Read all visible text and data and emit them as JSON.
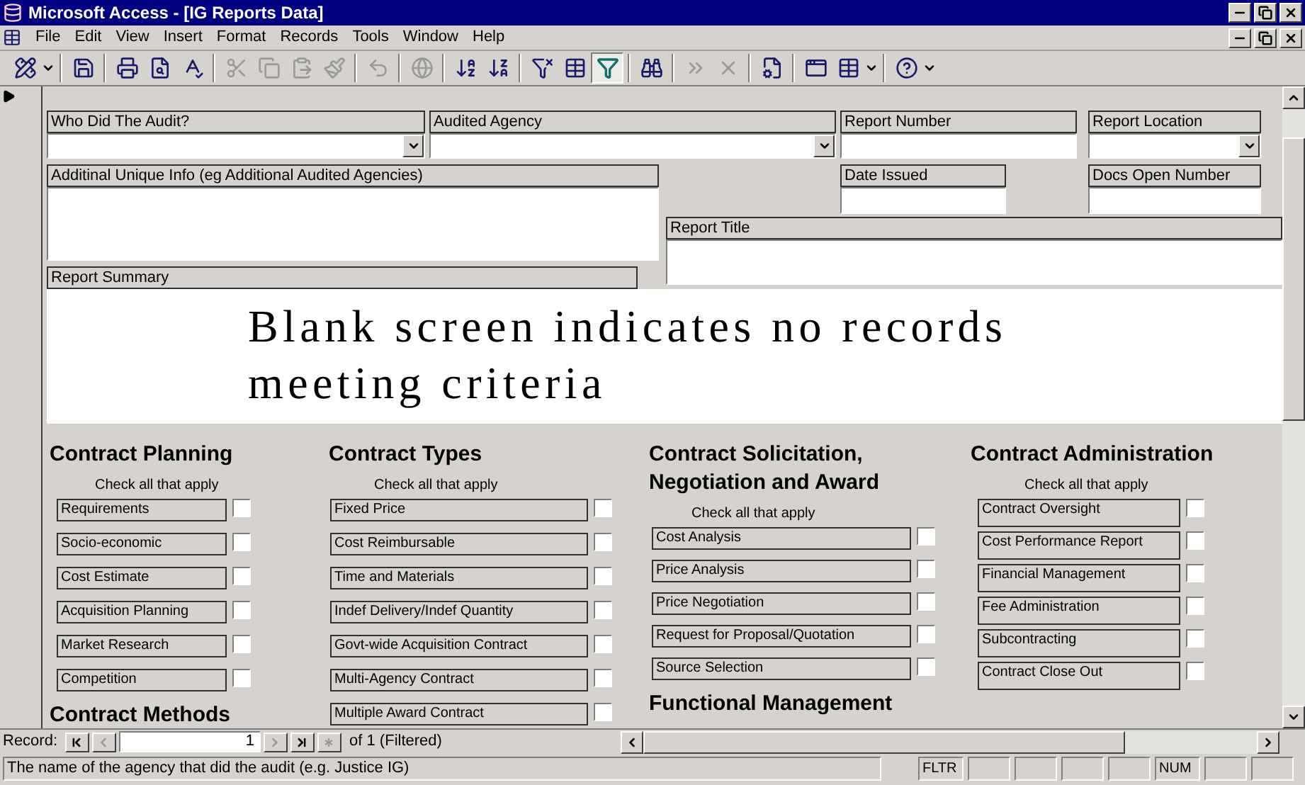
{
  "window": {
    "title": "Microsoft Access - [IG Reports Data]"
  },
  "menu": [
    "File",
    "Edit",
    "View",
    "Insert",
    "Format",
    "Records",
    "Tools",
    "Window",
    "Help"
  ],
  "toolbar": {
    "filter_on": true
  },
  "fields": [
    {
      "label": "Who Did The Audit?",
      "kind": "combo"
    },
    {
      "label": "Audited Agency",
      "kind": "combo"
    },
    {
      "label": "Report Number",
      "kind": "text"
    },
    {
      "label": "Report Location",
      "kind": "combo"
    },
    {
      "label": "Additinal Unique Info (eg Additional Audited Agencies)",
      "kind": "memo"
    },
    {
      "label": "Date Issued",
      "kind": "text"
    },
    {
      "label": "Docs Open Number",
      "kind": "text"
    },
    {
      "label": "Report Title",
      "kind": "memo"
    }
  ],
  "summary": {
    "label": "Report Summary",
    "message": "Blank screen indicates no records meeting criteria"
  },
  "sections": [
    {
      "title": "Contract Planning",
      "subtitle": "Check all that apply",
      "items": [
        {
          "label": "Requirements",
          "checked": false
        },
        {
          "label": "Socio-economic",
          "checked": false
        },
        {
          "label": "Cost Estimate",
          "checked": false
        },
        {
          "label": "Acquisition Planning",
          "checked": false
        },
        {
          "label": "Market Research",
          "checked": false
        },
        {
          "label": "Competition",
          "checked": false
        }
      ],
      "next_heading": "Contract Methods"
    },
    {
      "title": "Contract Types",
      "subtitle": "Check all that apply",
      "items": [
        {
          "label": "Fixed Price",
          "checked": false
        },
        {
          "label": "Cost Reimbursable",
          "checked": false
        },
        {
          "label": "Time and Materials",
          "checked": false
        },
        {
          "label": "Indef Delivery/Indef Quantity",
          "checked": false
        },
        {
          "label": "Govt-wide Acquisition Contract",
          "checked": false
        },
        {
          "label": "Multi-Agency Contract",
          "checked": false
        },
        {
          "label": "Multiple Award Contract",
          "checked": false
        }
      ]
    },
    {
      "title": "Contract Solicitation, Negotiation and Award",
      "subtitle": "Check all that apply",
      "items": [
        {
          "label": "Cost Analysis",
          "checked": false
        },
        {
          "label": "Price Analysis",
          "checked": false
        },
        {
          "label": "Price Negotiation",
          "checked": false
        },
        {
          "label": "Request for Proposal/Quotation",
          "checked": false
        },
        {
          "label": "Source Selection",
          "checked": false
        }
      ],
      "next_heading": "Functional Management"
    },
    {
      "title": "Contract Administration",
      "subtitle": "Check all that apply",
      "items": [
        {
          "label": "Contract Oversight",
          "checked": false
        },
        {
          "label": "Cost Performance Report",
          "checked": false
        },
        {
          "label": "Financial Management",
          "checked": false
        },
        {
          "label": "Fee Administration",
          "checked": false
        },
        {
          "label": "Subcontracting",
          "checked": false
        },
        {
          "label": "Contract Close Out",
          "checked": false
        }
      ]
    }
  ],
  "record_nav": {
    "label": "Record:",
    "current": "1",
    "total": "of 1 (Filtered)"
  },
  "status_bar": {
    "message": "The name of the agency that did the audit (e.g. Justice IG)",
    "indicators": [
      {
        "text": "FLTR"
      },
      {
        "text": "NUM"
      }
    ]
  }
}
